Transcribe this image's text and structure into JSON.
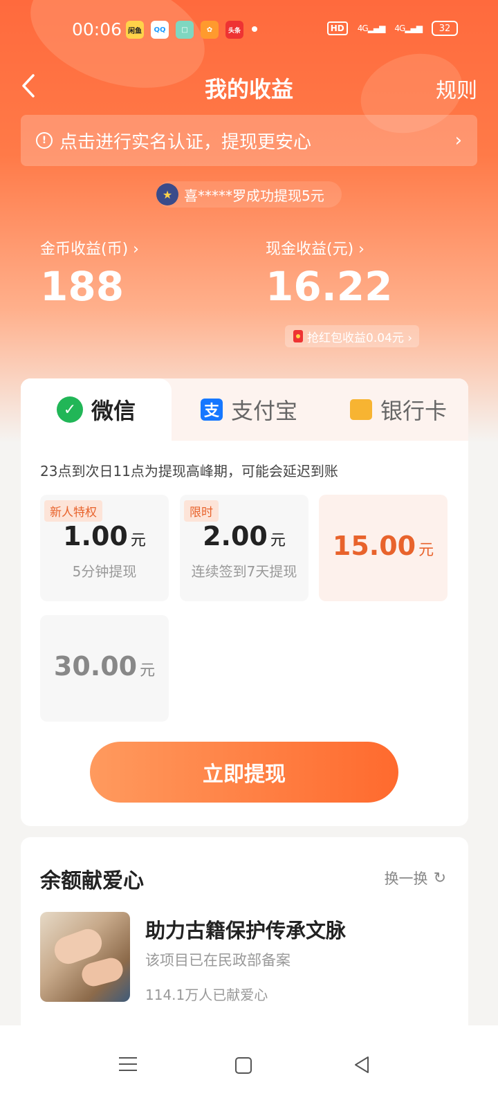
{
  "status_bar": {
    "time": "00:06",
    "apps": [
      "闲鱼",
      "QQ",
      "□",
      "✿",
      "头条"
    ],
    "network_labels": [
      "HD",
      "4G",
      "4G"
    ],
    "battery": "32"
  },
  "header": {
    "title": "我的收益",
    "rules_label": "规则"
  },
  "notice": {
    "icon_glyph": "!",
    "text": "点击进行实名认证，提现更安心",
    "chevron": "›"
  },
  "ticker": {
    "text": "喜*****罗成功提现5元"
  },
  "earnings": {
    "coins_label": "金币收益(币) ›",
    "coins_value": "188",
    "cash_label": "现金收益(元) ›",
    "cash_value": "16.22",
    "red_packet_label": "抢红包收益0.04元 ›"
  },
  "withdraw": {
    "tabs": [
      {
        "label": "微信",
        "icon": "wechat-icon",
        "active": true
      },
      {
        "label": "支付宝",
        "icon": "alipay-icon",
        "active": false
      },
      {
        "label": "银行卡",
        "icon": "bank-card-icon",
        "active": false
      }
    ],
    "peak_notice": "23点到次日11点为提现高峰期，可能会延迟到账",
    "options": [
      {
        "tag": "新人特权",
        "amount": "1.00",
        "unit": "元",
        "sub": "5分钟提现"
      },
      {
        "tag": "限时",
        "amount": "2.00",
        "unit": "元",
        "sub": "连续签到7天提现"
      },
      {
        "tag": "",
        "amount": "15.00",
        "unit": "元",
        "sub": "",
        "selected": true
      },
      {
        "tag": "",
        "amount": "30.00",
        "unit": "元",
        "sub": ""
      }
    ],
    "submit_label": "立即提现"
  },
  "donation": {
    "heading": "余额献爱心",
    "swap_label": "换一换",
    "project_title": "助力古籍保护传承文脉",
    "project_sub": "该项目已在民政部备案",
    "project_count": "114.1万人已献爱心"
  },
  "colors": {
    "accent": "#ff6a2e",
    "wechat": "#21b657",
    "alipay": "#1677ff",
    "bank": "#f7b432"
  }
}
